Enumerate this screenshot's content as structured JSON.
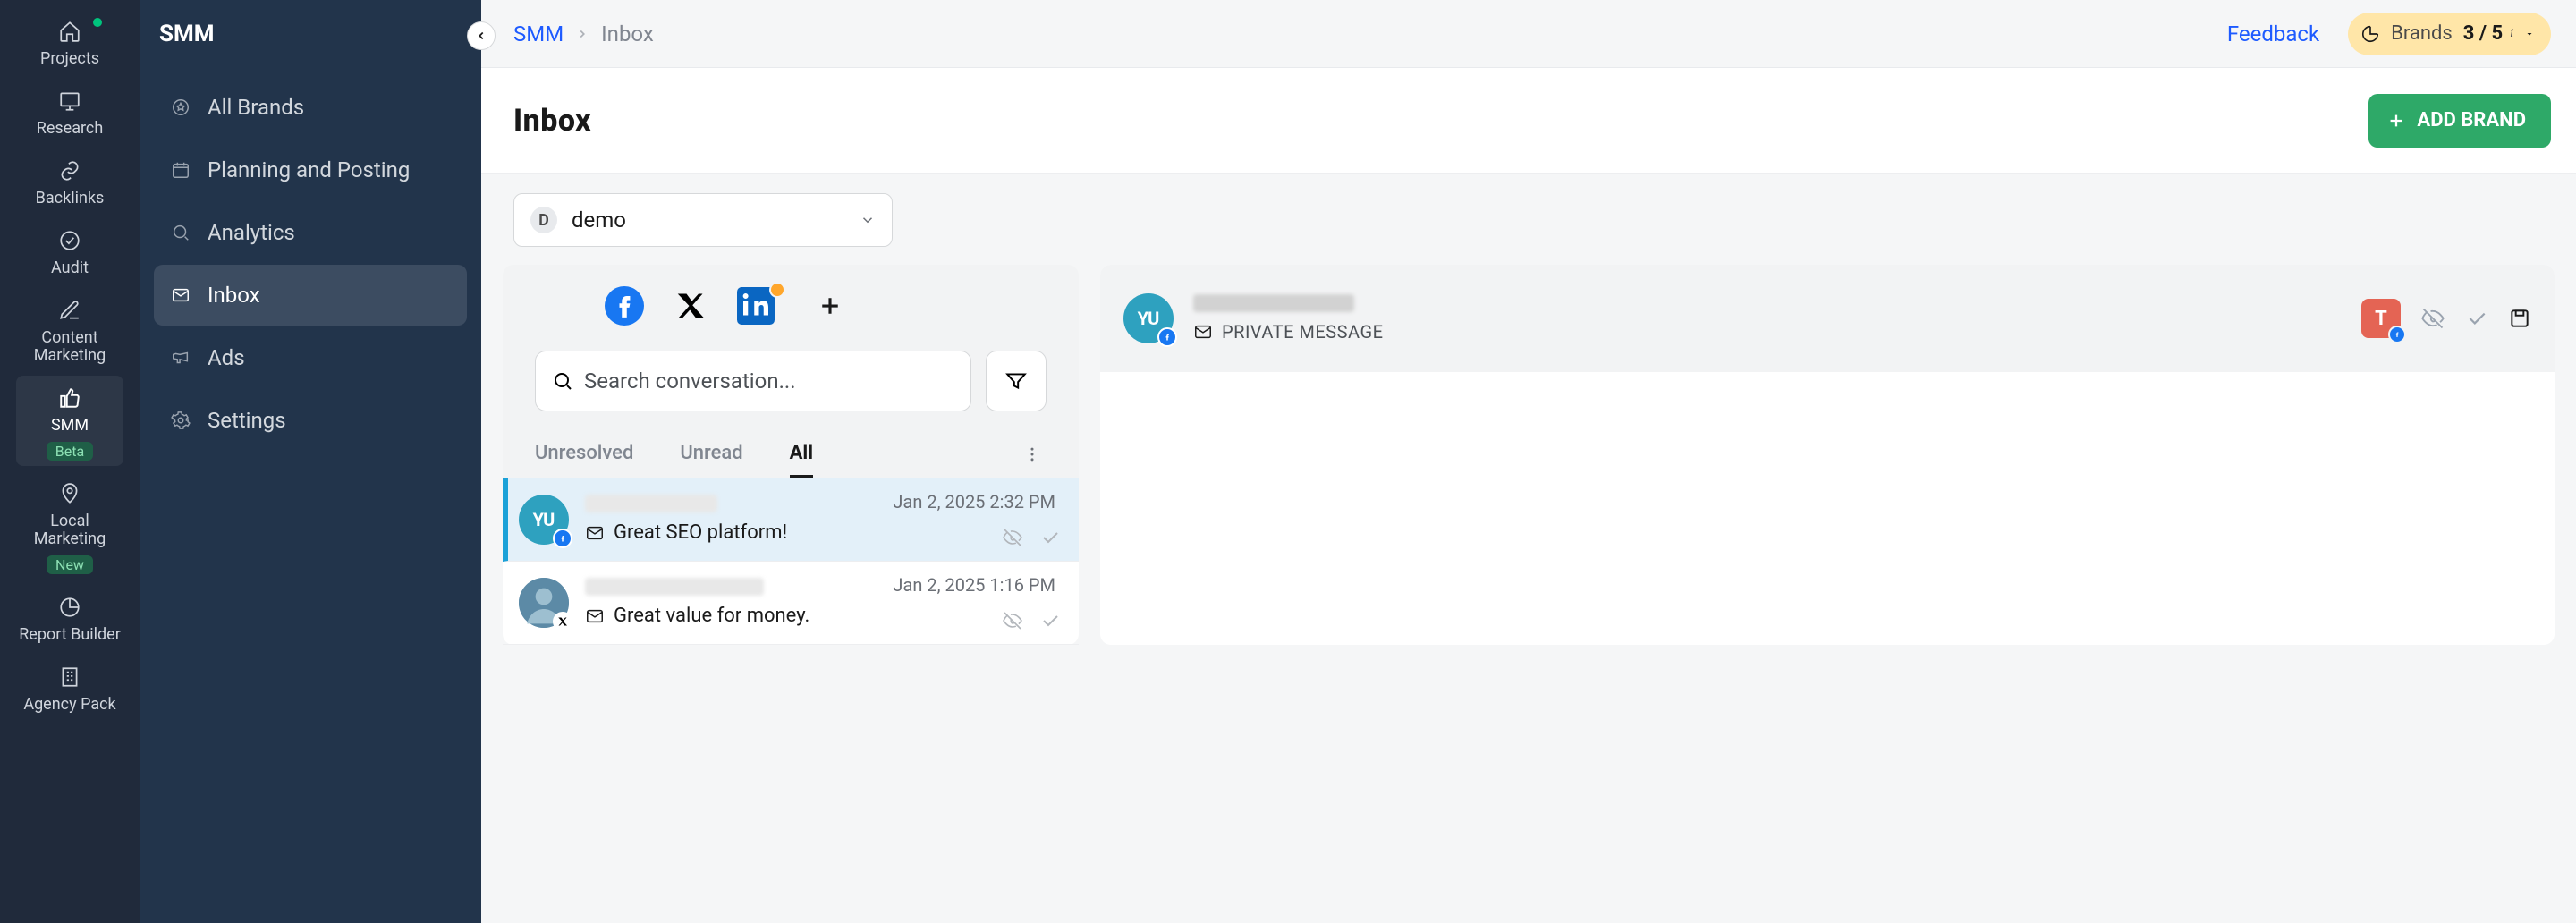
{
  "rail": {
    "items": [
      {
        "label": "Projects"
      },
      {
        "label": "Research"
      },
      {
        "label": "Backlinks"
      },
      {
        "label": "Audit"
      },
      {
        "label": "Content Marketing"
      },
      {
        "label": "SMM",
        "badge": "Beta"
      },
      {
        "label": "Local Marketing",
        "badge": "New"
      },
      {
        "label": "Report Builder"
      },
      {
        "label": "Agency Pack"
      }
    ]
  },
  "sidebar": {
    "title": "SMM",
    "items": [
      {
        "label": "All Brands"
      },
      {
        "label": "Planning and Posting"
      },
      {
        "label": "Analytics"
      },
      {
        "label": "Inbox"
      },
      {
        "label": "Ads"
      },
      {
        "label": "Settings"
      }
    ]
  },
  "breadcrumb": {
    "root": "SMM",
    "current": "Inbox"
  },
  "topbar": {
    "feedback": "Feedback",
    "brands_label": "Brands",
    "brands_count": "3 / 5"
  },
  "page": {
    "title": "Inbox",
    "add_brand": "ADD BRAND"
  },
  "brand_select": {
    "letter": "D",
    "name": "demo"
  },
  "search": {
    "placeholder": "Search conversation..."
  },
  "tabs": {
    "unresolved": "Unresolved",
    "unread": "Unread",
    "all": "All"
  },
  "conversations": [
    {
      "initials": "YU",
      "network": "facebook",
      "message": "Great SEO platform!",
      "date": "Jan 2, 2025 2:32 PM",
      "active": true
    },
    {
      "initials": "",
      "network": "x",
      "message": "Great value for money.",
      "date": "Jan 2, 2025 1:16 PM",
      "active": false
    }
  ],
  "detail": {
    "type_label": "PRIVATE MESSAGE",
    "assignee_initial": "T"
  },
  "colors": {
    "accent_blue": "#1e5bff",
    "green": "#2ea968",
    "facebook": "#1877f2",
    "linkedin": "#0a66c2"
  }
}
